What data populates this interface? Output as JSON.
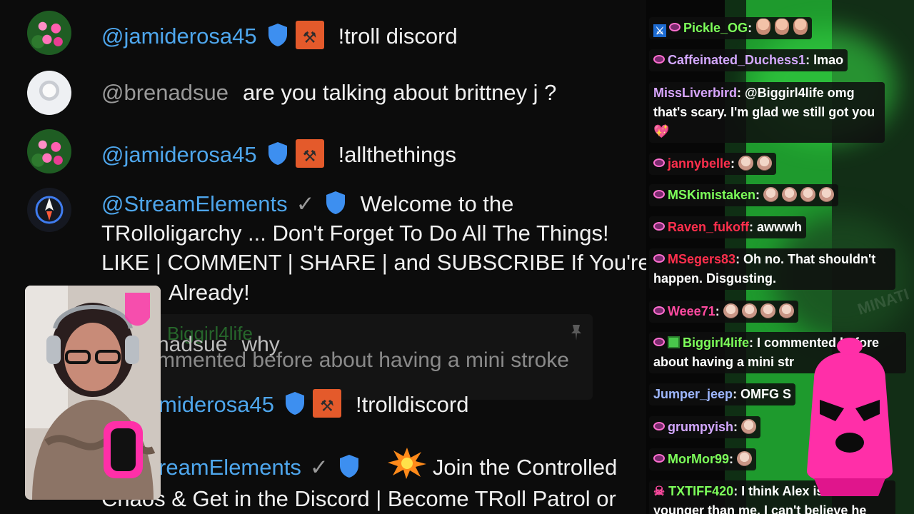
{
  "left_chat": {
    "messages": [
      {
        "handle": "@jamiderosa45",
        "text": "!troll discord"
      },
      {
        "handle": "@brenadsue",
        "text": "are you talking about brittney j ?"
      },
      {
        "handle": "@jamiderosa45",
        "text": "!allthethings"
      },
      {
        "handle": "@StreamElements",
        "text": "Welcome to the",
        "cont_1": "TRolloligarchy ... Don't Forget To Do All The Things!",
        "cont_2": "LIKE | COMMENT | SHARE | and SUBSCRIBE If You're",
        "cont_3": "Already!"
      },
      {
        "handle": "@jamiderosa45",
        "handle_visible": "miderosa45",
        "text": "!trolldiscord"
      },
      {
        "handle": "@StreamElements",
        "handle_visible": "reamElements",
        "text": "Join the Controlled",
        "cont_1": "Chaos & Get in the Discord | Become TRoll Patrol or"
      }
    ],
    "pinned": {
      "name": "Biggirl4life",
      "user": "nadsue",
      "user_text": "why",
      "text": "mmented before about having a mini stroke"
    }
  },
  "right_chat": {
    "rows": [
      {
        "user": "Pickle_OG",
        "color": "#7dff5a",
        "text": ""
      },
      {
        "user": "Caffeinated_Duchess1",
        "color": "#d4a8ff",
        "text": ": lmao"
      },
      {
        "user": "MissLiverbird",
        "color": "#d9a6ff",
        "text": ": @Biggirl4life omg",
        "cont_1": "that's scary. I'm glad we still got you"
      },
      {
        "user": "jannybelle",
        "color": "#ff2f4d",
        "text": ":"
      },
      {
        "user": "MSKimistaken",
        "color": "#7dff5a",
        "text": ":"
      },
      {
        "user": "Raven_fukoff",
        "color": "#ff2f4d",
        "text": ": awwwh"
      },
      {
        "user": "MSegers83",
        "color": "#ff2f4d",
        "text": ": Oh no. That shouldn't",
        "cont_1": "happen. Disgusting."
      },
      {
        "user": "Weee71",
        "color": "#ff4aa0",
        "text": ":"
      },
      {
        "user": "Biggirl4life",
        "color": "#7dff5a",
        "text": ": I commented before",
        "cont_1": "about having a mini str"
      },
      {
        "user": "Jumper_jeep",
        "color": "#9fb8ff",
        "text": ": OMFG S"
      },
      {
        "user": "grumpyish",
        "color": "#d4a8ff",
        "text": ":"
      },
      {
        "user": "MorMor99",
        "color": "#7dff5a",
        "text": ":"
      },
      {
        "user": "TXTIFF420",
        "color": "#7dff5a",
        "text": ": I think Alex is as",
        "cont_1": "younger than me. I can't believe he"
      }
    ],
    "watermark": "MINATI"
  },
  "colors": {
    "handle_blue": "#4ea6ec",
    "mod_badge": "#e45a2b",
    "mask_pink": "#ff2fa8",
    "green_screen": "#1e9a2d"
  },
  "icons": [
    "verified-shield-icon",
    "mod-badge-icon",
    "checkmark-icon",
    "pin-icon",
    "subscriber-badge-icon",
    "gift-icon",
    "moderator-sword-icon",
    "heart-emoji",
    "explosion-emoji"
  ]
}
